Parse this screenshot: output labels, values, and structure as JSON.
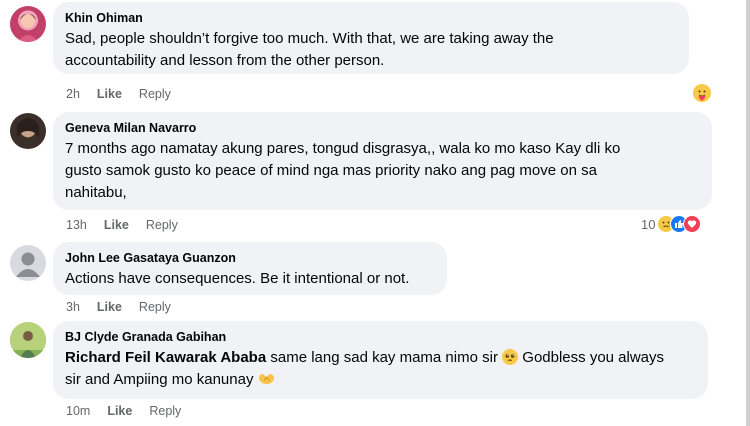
{
  "comments": [
    {
      "author": "Khin Ohiman",
      "text_lines": [
        "Sad, people shouldn’t forgive too much. With that, we are taking away the",
        "accountability and lesson from the other person."
      ],
      "time": "2h",
      "like": "Like",
      "reply": "Reply",
      "reaction_icon": "care-emoji-icon"
    },
    {
      "author": "Geneva Milan Navarro",
      "text_lines": [
        "7 months ago namatay akung pares, tongud disgrasya,, wala ko mo kaso Kay dli ko",
        "gusto samok gusto ko peace of mind nga mas priority nako ang pag move on sa",
        "nahitabu,"
      ],
      "time": "13h",
      "like": "Like",
      "reply": "Reply",
      "reaction_count": "10",
      "reaction_icons": [
        "sad-emoji-icon",
        "like-reaction-icon",
        "love-reaction-icon"
      ]
    },
    {
      "author": "John Lee Gasataya Guanzon",
      "text_lines": [
        "Actions have consequences. Be it intentional or not."
      ],
      "time": "3h",
      "like": "Like",
      "reply": "Reply"
    },
    {
      "author": "BJ Clyde Granada Gabihan",
      "mention": "Richard Feil Kawarak Ababa",
      "text_after_mention": " same lang sad kay mama nimo sir ",
      "text_after_emoji": " Godbless you always",
      "line2": "sir and Ampiing mo kanunay ",
      "time": "10m",
      "like": "Like",
      "reply": "Reply"
    }
  ],
  "colors": {
    "bubble": "#f0f2f5",
    "meta": "#65676b",
    "like_blue": "#1877f2",
    "love_red": "#f33e58"
  }
}
